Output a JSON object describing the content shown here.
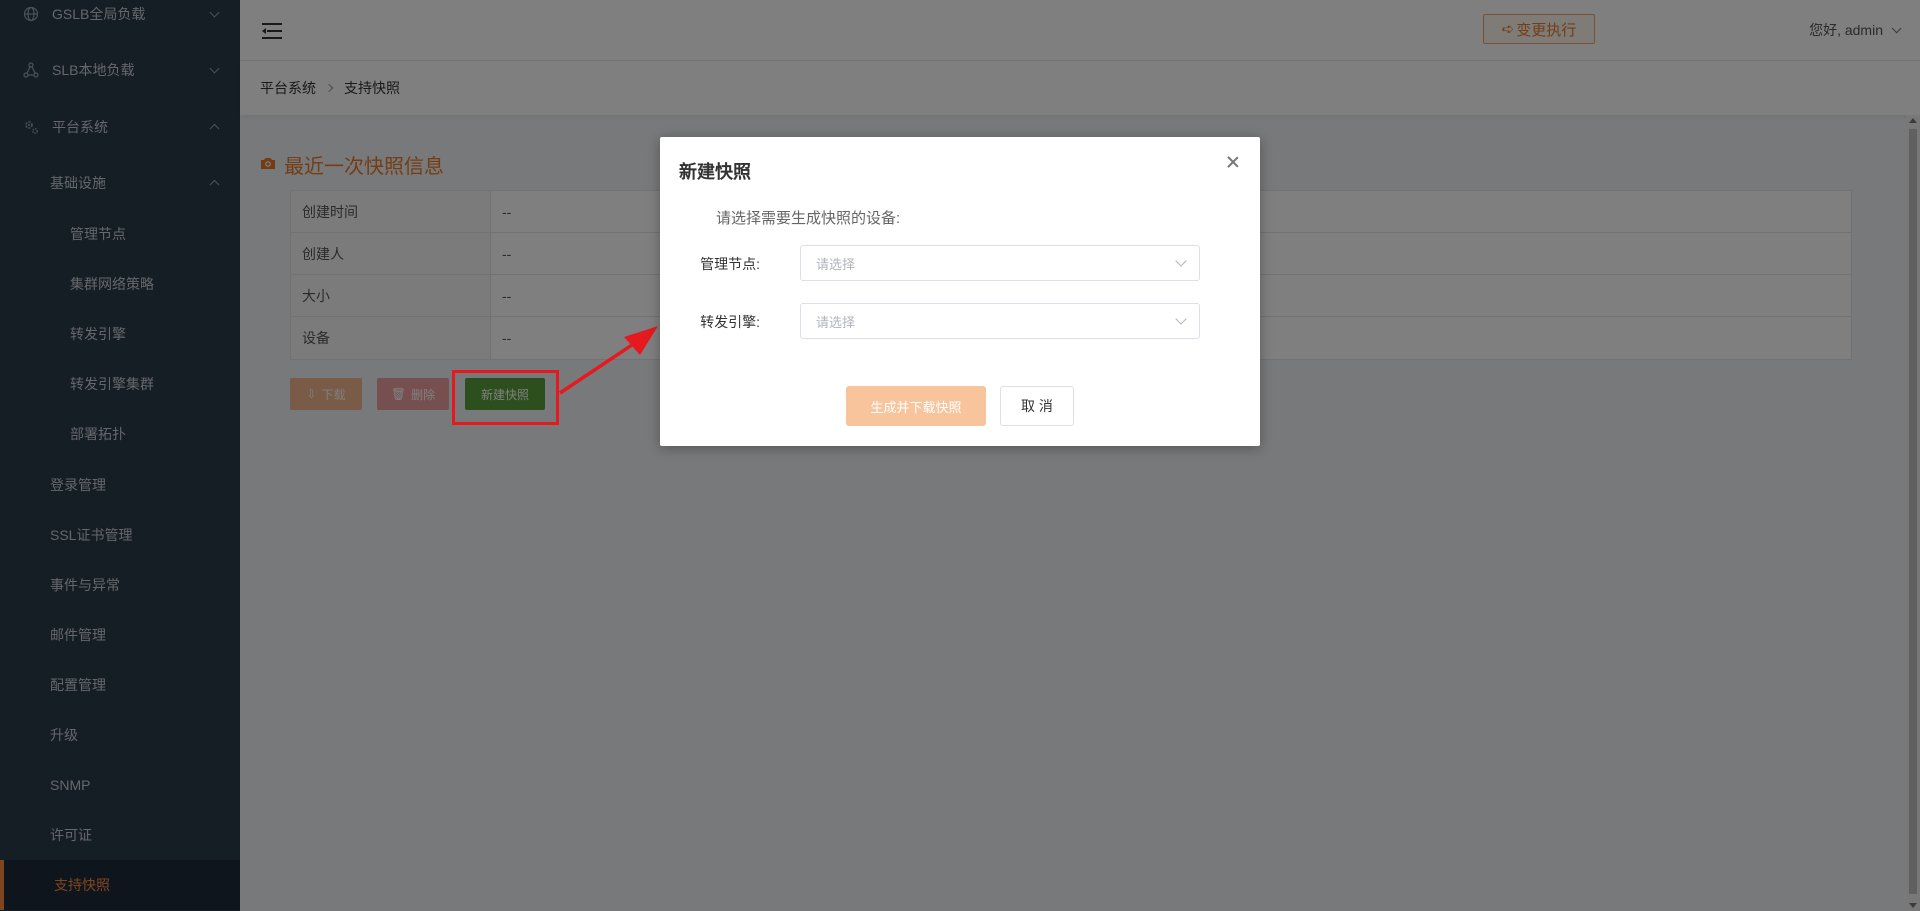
{
  "sidebar": {
    "items": [
      {
        "label": "GSLB全局负载",
        "icon": "globe-icon"
      },
      {
        "label": "SLB本地负载",
        "icon": "share-icon"
      },
      {
        "label": "平台系统",
        "icon": "gear-icon"
      },
      {
        "label": "基础设施"
      },
      {
        "label": "管理节点"
      },
      {
        "label": "集群网络策略"
      },
      {
        "label": "转发引擎"
      },
      {
        "label": "转发引擎集群"
      },
      {
        "label": "部署拓扑"
      },
      {
        "label": "登录管理"
      },
      {
        "label": "SSL证书管理"
      },
      {
        "label": "事件与异常"
      },
      {
        "label": "邮件管理"
      },
      {
        "label": "配置管理"
      },
      {
        "label": "升级"
      },
      {
        "label": "SNMP"
      },
      {
        "label": "许可证"
      },
      {
        "label": "支持快照"
      }
    ]
  },
  "header": {
    "change_exec": "变更执行",
    "user_greeting": "您好, admin"
  },
  "breadcrumb": [
    "平台系统",
    "支持快照"
  ],
  "main": {
    "section_title": "最近一次快照信息",
    "rows": [
      {
        "label": "创建时间",
        "value": "--"
      },
      {
        "label": "创建人",
        "value": "--"
      },
      {
        "label": "大小",
        "value": "--"
      },
      {
        "label": "设备",
        "value": "--"
      }
    ],
    "download_label": "下载",
    "delete_label": "删除",
    "new_snapshot_label": "新建快照"
  },
  "modal": {
    "title": "新建快照",
    "hint": "请选择需要生成快照的设备:",
    "fields": [
      {
        "label": "管理节点:",
        "placeholder": "请选择"
      },
      {
        "label": "转发引擎:",
        "placeholder": "请选择"
      }
    ],
    "generate_label": "生成并下载快照",
    "cancel_label": "取 消"
  },
  "colors": {
    "sidebar_bg": "#2b3a4a",
    "accent": "#e97a2d",
    "new_button": "#5b9f3a",
    "highlight": "#e5191e"
  }
}
